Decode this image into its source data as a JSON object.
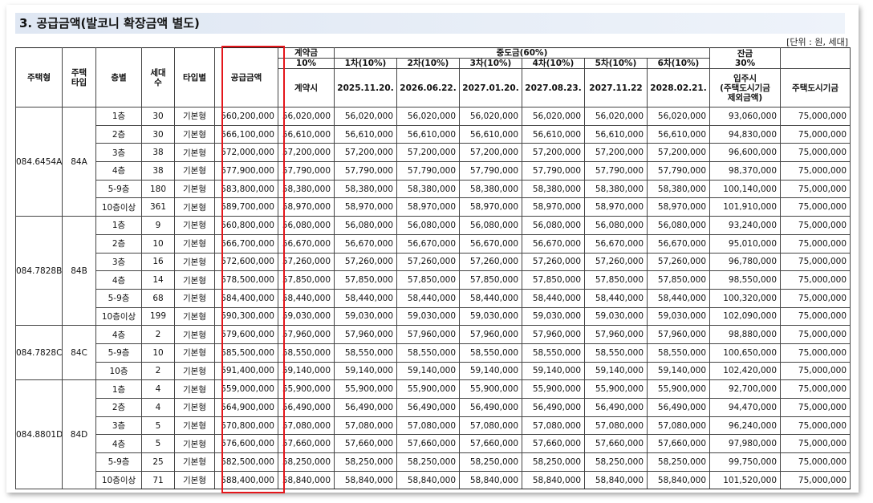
{
  "title": "3. 공급금액(발코니 확장금액 별도)",
  "unit_label": "[단위 : 원, 세대]",
  "headers": {
    "house_type": "주택형",
    "house_subtype": "주택\n타입",
    "floor": "층별",
    "households": "세대\n수",
    "type_by": "타입별",
    "supply_amount": "공급금액",
    "contract_group": "계약금",
    "contract_pct": "10%",
    "contract_when": "계약시",
    "middle_group": "중도금(60%)",
    "middle_installments": [
      {
        "label": "1차(10%)",
        "date": "2025.11.20."
      },
      {
        "label": "2차(10%)",
        "date": "2026.06.22."
      },
      {
        "label": "3차(10%)",
        "date": "2027.01.20."
      },
      {
        "label": "4차(10%)",
        "date": "2027.08.23."
      },
      {
        "label": "5차(10%)",
        "date": "2027.11.22"
      },
      {
        "label": "6차(10%)",
        "date": "2028.02.21."
      }
    ],
    "balance_group": "잔금\n30%",
    "balance_when": "입주시\n(주택도시기금\n제외금액)",
    "fund": "주택도시기금"
  },
  "groups": [
    {
      "house_type": "084.6454A",
      "subtype": "84A",
      "rows": [
        {
          "floor": "1층",
          "households": "30",
          "type": "기본형",
          "supply": "560,200,000",
          "contract": "56,020,000",
          "middle": "56,020,000",
          "balance": "93,060,000",
          "fund": "75,000,000"
        },
        {
          "floor": "2층",
          "households": "30",
          "type": "기본형",
          "supply": "566,100,000",
          "contract": "56,610,000",
          "middle": "56,610,000",
          "balance": "94,830,000",
          "fund": "75,000,000"
        },
        {
          "floor": "3층",
          "households": "38",
          "type": "기본형",
          "supply": "572,000,000",
          "contract": "57,200,000",
          "middle": "57,200,000",
          "balance": "96,600,000",
          "fund": "75,000,000"
        },
        {
          "floor": "4층",
          "households": "38",
          "type": "기본형",
          "supply": "577,900,000",
          "contract": "57,790,000",
          "middle": "57,790,000",
          "balance": "98,370,000",
          "fund": "75,000,000"
        },
        {
          "floor": "5-9층",
          "households": "180",
          "type": "기본형",
          "supply": "583,800,000",
          "contract": "58,380,000",
          "middle": "58,380,000",
          "balance": "100,140,000",
          "fund": "75,000,000"
        },
        {
          "floor": "10층이상",
          "households": "361",
          "type": "기본형",
          "supply": "589,700,000",
          "contract": "58,970,000",
          "middle": "58,970,000",
          "balance": "101,910,000",
          "fund": "75,000,000"
        }
      ]
    },
    {
      "house_type": "084.7828B",
      "subtype": "84B",
      "rows": [
        {
          "floor": "1층",
          "households": "9",
          "type": "기본형",
          "supply": "560,800,000",
          "contract": "56,080,000",
          "middle": "56,080,000",
          "balance": "93,240,000",
          "fund": "75,000,000"
        },
        {
          "floor": "2층",
          "households": "10",
          "type": "기본형",
          "supply": "566,700,000",
          "contract": "56,670,000",
          "middle": "56,670,000",
          "balance": "95,010,000",
          "fund": "75,000,000"
        },
        {
          "floor": "3층",
          "households": "16",
          "type": "기본형",
          "supply": "572,600,000",
          "contract": "57,260,000",
          "middle": "57,260,000",
          "balance": "96,780,000",
          "fund": "75,000,000"
        },
        {
          "floor": "4층",
          "households": "14",
          "type": "기본형",
          "supply": "578,500,000",
          "contract": "57,850,000",
          "middle": "57,850,000",
          "balance": "98,550,000",
          "fund": "75,000,000"
        },
        {
          "floor": "5-9층",
          "households": "68",
          "type": "기본형",
          "supply": "584,400,000",
          "contract": "58,440,000",
          "middle": "58,440,000",
          "balance": "100,320,000",
          "fund": "75,000,000"
        },
        {
          "floor": "10층이상",
          "households": "199",
          "type": "기본형",
          "supply": "590,300,000",
          "contract": "59,030,000",
          "middle": "59,030,000",
          "balance": "102,090,000",
          "fund": "75,000,000"
        }
      ]
    },
    {
      "house_type": "084.7828C",
      "subtype": "84C",
      "rows": [
        {
          "floor": "4층",
          "households": "2",
          "type": "기본형",
          "supply": "579,600,000",
          "contract": "57,960,000",
          "middle": "57,960,000",
          "balance": "98,880,000",
          "fund": "75,000,000"
        },
        {
          "floor": "5-9층",
          "households": "10",
          "type": "기본형",
          "supply": "585,500,000",
          "contract": "58,550,000",
          "middle": "58,550,000",
          "balance": "100,650,000",
          "fund": "75,000,000"
        },
        {
          "floor": "10층",
          "households": "2",
          "type": "기본형",
          "supply": "591,400,000",
          "contract": "59,140,000",
          "middle": "59,140,000",
          "balance": "102,420,000",
          "fund": "75,000,000"
        }
      ]
    },
    {
      "house_type": "084.8801D",
      "subtype": "84D",
      "rows": [
        {
          "floor": "1층",
          "households": "4",
          "type": "기본형",
          "supply": "559,000,000",
          "contract": "55,900,000",
          "middle": "55,900,000",
          "balance": "92,700,000",
          "fund": "75,000,000"
        },
        {
          "floor": "2층",
          "households": "4",
          "type": "기본형",
          "supply": "564,900,000",
          "contract": "56,490,000",
          "middle": "56,490,000",
          "balance": "94,470,000",
          "fund": "75,000,000"
        },
        {
          "floor": "3층",
          "households": "5",
          "type": "기본형",
          "supply": "570,800,000",
          "contract": "57,080,000",
          "middle": "57,080,000",
          "balance": "96,240,000",
          "fund": "75,000,000"
        },
        {
          "floor": "4층",
          "households": "5",
          "type": "기본형",
          "supply": "576,600,000",
          "contract": "57,660,000",
          "middle": "57,660,000",
          "balance": "97,980,000",
          "fund": "75,000,000"
        },
        {
          "floor": "5-9층",
          "households": "25",
          "type": "기본형",
          "supply": "582,500,000",
          "contract": "58,250,000",
          "middle": "58,250,000",
          "balance": "99,750,000",
          "fund": "75,000,000"
        },
        {
          "floor": "10층이상",
          "households": "71",
          "type": "기본형",
          "supply": "588,400,000",
          "contract": "58,840,000",
          "middle": "58,840,000",
          "balance": "101,520,000",
          "fund": "75,000,000"
        }
      ]
    }
  ],
  "highlight_color": "#e4161b"
}
